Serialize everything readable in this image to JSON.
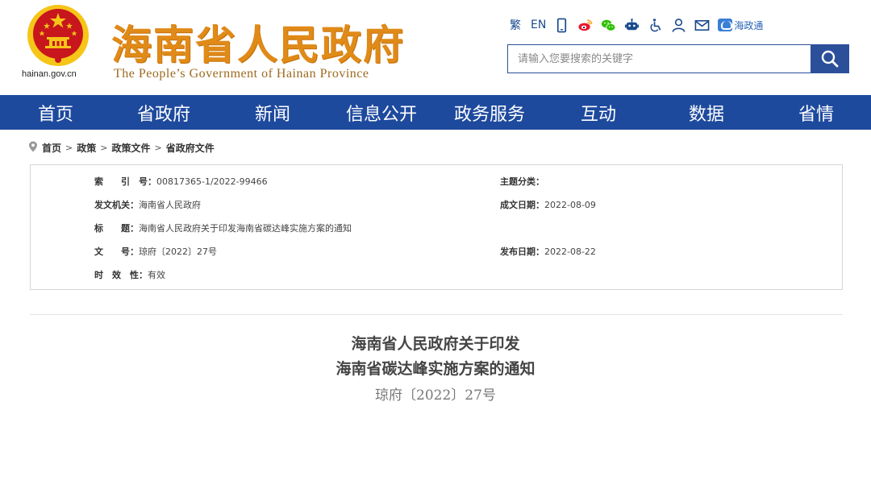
{
  "header": {
    "site_title": "海南省人民政府",
    "site_subtitle": "The People’s Government  of Hainan Province",
    "domain": "hainan.gov.cn",
    "toolbar": {
      "traditional": "繁",
      "english": "EN",
      "haizhengtong": "海政通"
    },
    "search": {
      "placeholder": "请输入您要搜索的关键字"
    },
    "colors": {
      "title": "#e08a18",
      "nav": "#1e4a9e",
      "emblem_red": "#c8161d",
      "emblem_gold": "#f5c518"
    }
  },
  "nav": {
    "items": [
      "首页",
      "省政府",
      "新闻",
      "信息公开",
      "政务服务",
      "互动",
      "数据",
      "省情"
    ]
  },
  "breadcrumb": {
    "items": [
      "首页",
      "政策",
      "政策文件",
      "省政府文件"
    ],
    "separator": ">"
  },
  "meta": {
    "index_label": "索　　引　号：",
    "index_value": "00817365-1/2022-99466",
    "category_label": "主题分类：",
    "category_value": "",
    "issuer_label": "发文机关：",
    "issuer_value": "海南省人民政府",
    "written_date_label": "成文日期：",
    "written_date_value": "2022-08-09",
    "title_label": "标　　题：",
    "title_value": "海南省人民政府关于印发海南省碳达峰实施方案的通知",
    "doc_no_label": "文　　号：",
    "doc_no_value": "琼府〔2022〕27号",
    "publish_date_label": "发布日期：",
    "publish_date_value": "2022-08-22",
    "validity_label": "时　效　性：",
    "validity_value": "有效"
  },
  "document": {
    "title_line1": "海南省人民政府关于印发",
    "title_line2": "海南省碳达峰实施方案的通知",
    "number": "琼府〔2022〕27号"
  }
}
